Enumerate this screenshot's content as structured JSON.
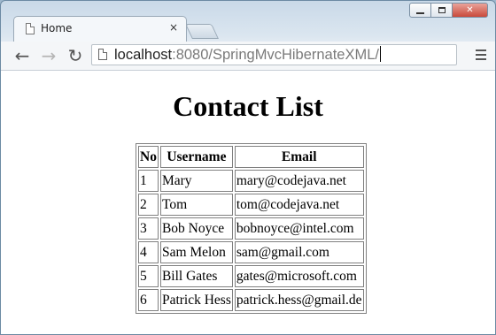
{
  "browser": {
    "tab_title": "Home",
    "tab_close": "×",
    "url_host": "localhost",
    "url_rest": ":8080/SpringMvcHibernateXML/"
  },
  "window_controls": {
    "close": "✕"
  },
  "page": {
    "title": "Contact List",
    "columns": [
      "No",
      "Username",
      "Email"
    ],
    "rows": [
      {
        "no": "1",
        "username": "Mary",
        "email": "mary@codejava.net"
      },
      {
        "no": "2",
        "username": "Tom",
        "email": "tom@codejava.net"
      },
      {
        "no": "3",
        "username": "Bob Noyce",
        "email": "bobnoyce@intel.com"
      },
      {
        "no": "4",
        "username": "Sam Melon",
        "email": "sam@gmail.com"
      },
      {
        "no": "5",
        "username": "Bill Gates",
        "email": "gates@microsoft.com"
      },
      {
        "no": "6",
        "username": "Patrick Hess",
        "email": "patrick.hess@gmail.de"
      }
    ]
  },
  "icons": {
    "back": "←",
    "forward": "→",
    "reload": "↻"
  }
}
